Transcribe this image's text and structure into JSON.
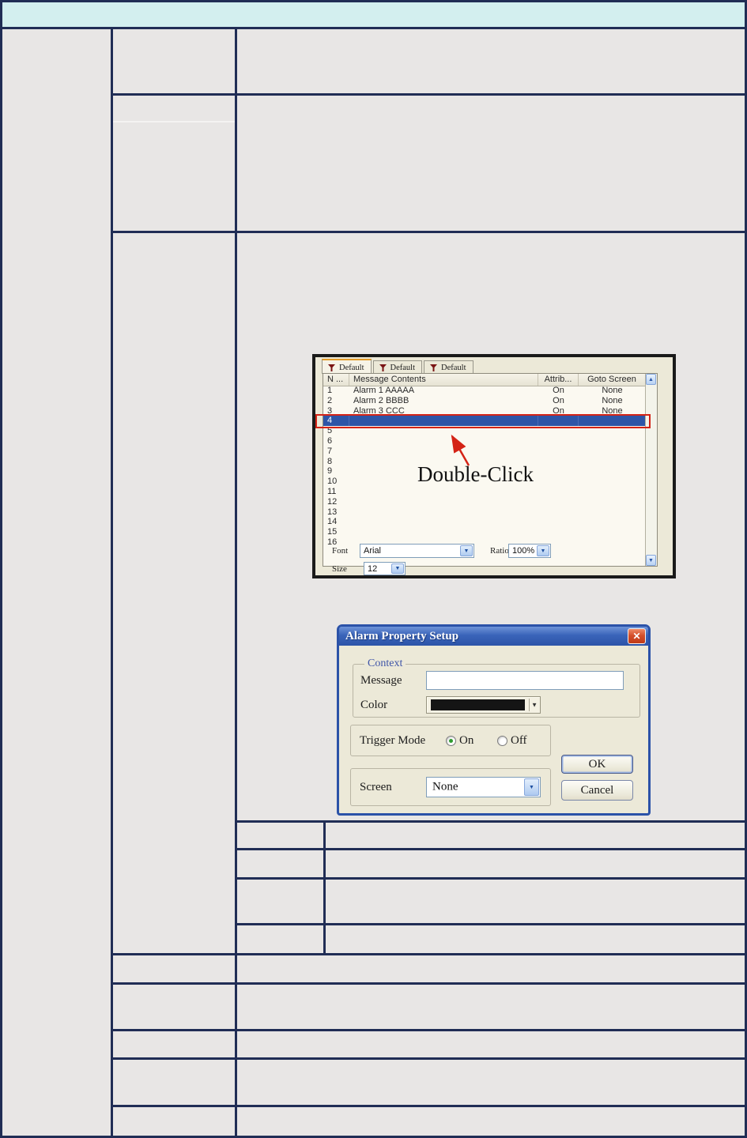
{
  "page": {
    "header_band": {
      "bg_color": "#d3efef"
    },
    "table": {
      "border_color": "#202d55",
      "cell_bg": "#e8e6e5"
    }
  },
  "alarm_list_window": {
    "bg_color": "#ece9d8",
    "tabs": [
      {
        "label": "Default"
      },
      {
        "label": "Default"
      },
      {
        "label": "Default"
      }
    ],
    "columns": {
      "number": "N ...",
      "message": "Message Contents",
      "attrib": "Attrib...",
      "goto": "Goto Screen"
    },
    "rows": [
      {
        "n": "1",
        "message": "Alarm 1 AAAAA",
        "attrib": "On",
        "goto": "None",
        "selected": false
      },
      {
        "n": "2",
        "message": "Alarm 2 BBBB",
        "attrib": "On",
        "goto": "None",
        "selected": false
      },
      {
        "n": "3",
        "message": "Alarm 3 CCC",
        "attrib": "On",
        "goto": "None",
        "selected": false
      },
      {
        "n": "4",
        "message": "",
        "attrib": "",
        "goto": "",
        "selected": true
      },
      {
        "n": "5",
        "message": "",
        "attrib": "",
        "goto": "",
        "selected": false
      },
      {
        "n": "6",
        "message": "",
        "attrib": "",
        "goto": "",
        "selected": false
      },
      {
        "n": "7",
        "message": "",
        "attrib": "",
        "goto": "",
        "selected": false
      },
      {
        "n": "8",
        "message": "",
        "attrib": "",
        "goto": "",
        "selected": false
      },
      {
        "n": "9",
        "message": "",
        "attrib": "",
        "goto": "",
        "selected": false
      },
      {
        "n": "10",
        "message": "",
        "attrib": "",
        "goto": "",
        "selected": false
      },
      {
        "n": "11",
        "message": "",
        "attrib": "",
        "goto": "",
        "selected": false
      },
      {
        "n": "12",
        "message": "",
        "attrib": "",
        "goto": "",
        "selected": false
      },
      {
        "n": "13",
        "message": "",
        "attrib": "",
        "goto": "",
        "selected": false
      },
      {
        "n": "14",
        "message": "",
        "attrib": "",
        "goto": "",
        "selected": false
      },
      {
        "n": "15",
        "message": "",
        "attrib": "",
        "goto": "",
        "selected": false
      },
      {
        "n": "16",
        "message": "",
        "attrib": "",
        "goto": "",
        "selected": false
      }
    ],
    "selection_color": "#2e55a7",
    "annotation": {
      "label": "Double-Click",
      "arrow_color": "#d42316"
    },
    "controls": {
      "font_label": "Font",
      "font_value": "Arial",
      "ratio_label": "Ratio",
      "ratio_value": "100%",
      "size_label": "Size",
      "size_value": "12"
    }
  },
  "alarm_property_dialog": {
    "title": "Alarm Property Setup",
    "context": {
      "group_label": "Context",
      "message_label": "Message",
      "message_value": "",
      "color_label": "Color",
      "color_value": "#151515"
    },
    "trigger": {
      "label": "Trigger Mode",
      "on_label": "On",
      "off_label": "Off",
      "selected": "On"
    },
    "screen": {
      "label": "Screen",
      "value": "None"
    },
    "buttons": {
      "ok": "OK",
      "cancel": "Cancel"
    }
  }
}
